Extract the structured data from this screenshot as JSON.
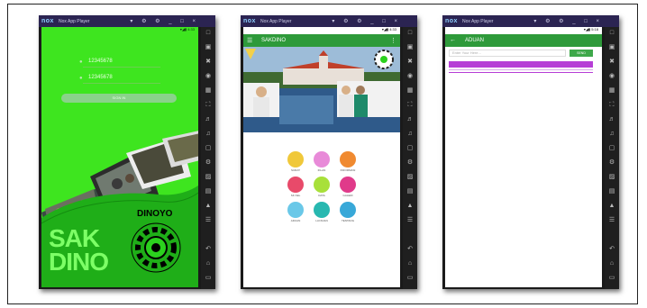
{
  "window": {
    "logo": "nox",
    "title": "Nox App Player",
    "controls": "▾ ⚙ ⚙ _ □ ×"
  },
  "phone1": {
    "status_time": "▾◢▮ 4:33",
    "username_value": "12345678",
    "password_value": "12345678",
    "signin_label": "SIGN IN",
    "brand_left": "SAK\nDINO",
    "brand_right": "DINOYO"
  },
  "phone2": {
    "status_time": "▾◢▮ 4:33",
    "appbar_title": "SAKDINO",
    "menu": [
      {
        "label": "SURAT",
        "color": "#f0c83a"
      },
      {
        "label": "IKLAN",
        "color": "#e88ad8"
      },
      {
        "label": "INFORMASI",
        "color": "#f08a30"
      },
      {
        "label": "SK KEL",
        "color": "#e84a6a"
      },
      {
        "label": "DATA",
        "color": "#a8e03a"
      },
      {
        "label": "GALERI",
        "color": "#e03a8a"
      },
      {
        "label": "ADUAN",
        "color": "#6ac8e8"
      },
      {
        "label": "LAYANAN",
        "color": "#28b8b0"
      },
      {
        "label": "TENTANG",
        "color": "#38a8d8"
      }
    ]
  },
  "phone3": {
    "status_time": "▾◢▮ 5:18",
    "appbar_title": "ADUAN",
    "search_placeholder": "Enter Your Here...",
    "search_button": "SEND",
    "accent": "#b63ed6"
  }
}
